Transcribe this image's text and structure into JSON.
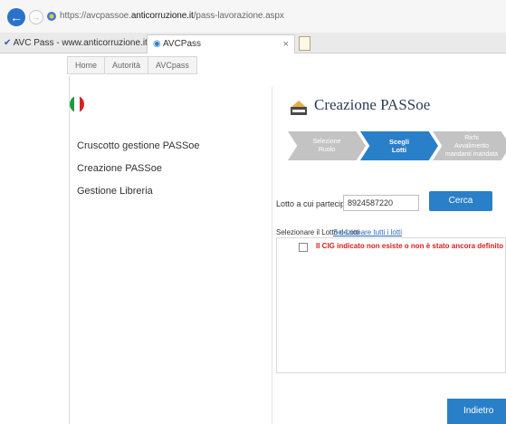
{
  "browser": {
    "url_prefix": "https://avcpassoe.",
    "url_host": "anticorruzione.it",
    "url_path": "/pass-lavorazione.aspx",
    "tabs": [
      {
        "label": "AVC Pass - www.anticorruzione.it"
      },
      {
        "label": "AVCPass"
      }
    ]
  },
  "breadcrumb": [
    "Home",
    "Autorità",
    "AVCpass"
  ],
  "sidebar": {
    "items": [
      {
        "label": "Cruscotto gestione PASSoe"
      },
      {
        "label": "Creazione PASSoe"
      },
      {
        "label": "Gestione Libreria"
      }
    ]
  },
  "main": {
    "title": "Creazione PASSoe",
    "steps": [
      {
        "line1": "Selezione",
        "line2": "Ruolo"
      },
      {
        "line1": "Scegli",
        "line2": "Lotti"
      },
      {
        "line1": "Richi",
        "line2": "Avvalimento",
        "line3": "mandanti mandata"
      }
    ],
    "lotto_label": "Lotto a cui partecipare :",
    "lotto_value": "8924587220",
    "search_button": "Cerca",
    "select_label": "Selezionare il Lotto o Lotti",
    "select_all_link": "Selezionare tutti i lotti",
    "error_message": "Il CIG indicato non esiste o non è stato ancora definito",
    "back_button": "Indietro"
  },
  "colors": {
    "accent": "#2a7fc9",
    "error": "#d42020",
    "flag_green": "#1f9a3c",
    "flag_red": "#d5232a"
  }
}
